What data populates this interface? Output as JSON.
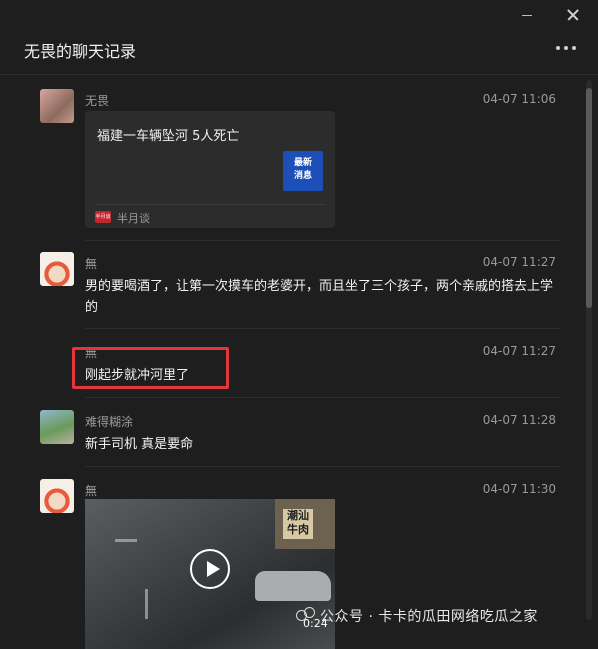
{
  "window": {
    "title": "无畏的聊天记录"
  },
  "messages": [
    {
      "sender": "无畏",
      "time": "04-07 11:06",
      "card": {
        "title": "福建一车辆坠河 5人死亡",
        "thumb_text": "最新\n消息",
        "source": "半月谈",
        "source_logo_text": "半月谈"
      }
    },
    {
      "sender": "無",
      "time": "04-07 11:27",
      "text": "男的要喝酒了，让第一次摸车的老婆开，而且坐了三个孩子，两个亲戚的搭去上学的"
    },
    {
      "sender": "無",
      "time": "04-07 11:27",
      "text": "刚起步就冲河里了"
    },
    {
      "sender": "难得糊涂",
      "time": "04-07 11:28",
      "text": "新手司机   真是要命"
    },
    {
      "sender": "無",
      "time": "04-07 11:30",
      "video": {
        "duration": "0:24",
        "sign_text": "潮汕\n牛肉"
      }
    }
  ],
  "watermark": {
    "text": "公众号 · 卡卡的瓜田网络吃瓜之家"
  },
  "colors": {
    "background": "#1e1e1e",
    "highlight": "#e3363b",
    "card": "#2c2c2c"
  },
  "icons": [
    "minimize-icon",
    "close-icon",
    "more-icon",
    "play-icon",
    "wechat-icon"
  ]
}
